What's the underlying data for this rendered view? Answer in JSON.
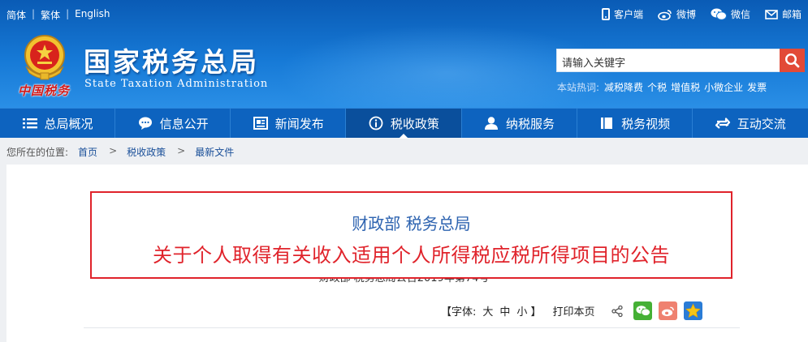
{
  "topbar": {
    "languages": [
      "简体",
      "繁体",
      "English"
    ],
    "separator": "|",
    "links": [
      {
        "label": "客户端",
        "icon": "phone-icon"
      },
      {
        "label": "微博",
        "icon": "weibo-icon"
      },
      {
        "label": "微信",
        "icon": "wechat-icon"
      },
      {
        "label": "邮箱",
        "icon": "mail-icon"
      }
    ]
  },
  "brand": {
    "title": "国家税务总局",
    "subtitle": "State Taxation Administration",
    "emblem_text": "中国税务"
  },
  "search": {
    "placeholder": "请输入关键字",
    "hot_label": "本站热词:",
    "hot_keywords": [
      "减税降费",
      "个税",
      "增值税",
      "小微企业",
      "发票"
    ]
  },
  "nav": {
    "items": [
      {
        "label": "总局概况",
        "icon": "menu-icon",
        "active": false
      },
      {
        "label": "信息公开",
        "icon": "chat-bubble-icon",
        "active": false
      },
      {
        "label": "新闻发布",
        "icon": "newspaper-icon",
        "active": false
      },
      {
        "label": "税收政策",
        "icon": "info-icon",
        "active": true
      },
      {
        "label": "纳税服务",
        "icon": "user-icon",
        "active": false
      },
      {
        "label": "税务视频",
        "icon": "book-icon",
        "active": false
      },
      {
        "label": "互动交流",
        "icon": "exchange-icon",
        "active": false
      }
    ]
  },
  "breadcrumb": {
    "prefix": "您所在的位置:",
    "arrow": ">",
    "items": [
      "首页",
      "税收政策",
      "最新文件"
    ]
  },
  "article": {
    "issuer": "财政部 税务总局",
    "title": "关于个人取得有关收入适用个人所得税应税所得项目的公告",
    "doc_number": "财政部 税务总局公告2019年第74号"
  },
  "tools": {
    "font_label": "【字体:",
    "sizes": [
      "大",
      "中",
      "小"
    ],
    "font_end": "】",
    "print_label": "打印本页"
  },
  "colors": {
    "header_blue": "#1679d6",
    "nav_blue": "#0d63bf",
    "nav_active": "#0a4f9c",
    "search_red": "#e24a37",
    "title_red": "#e0232b",
    "issuer_blue": "#2d63b0",
    "breadcrumb_link": "#1a4f99"
  }
}
